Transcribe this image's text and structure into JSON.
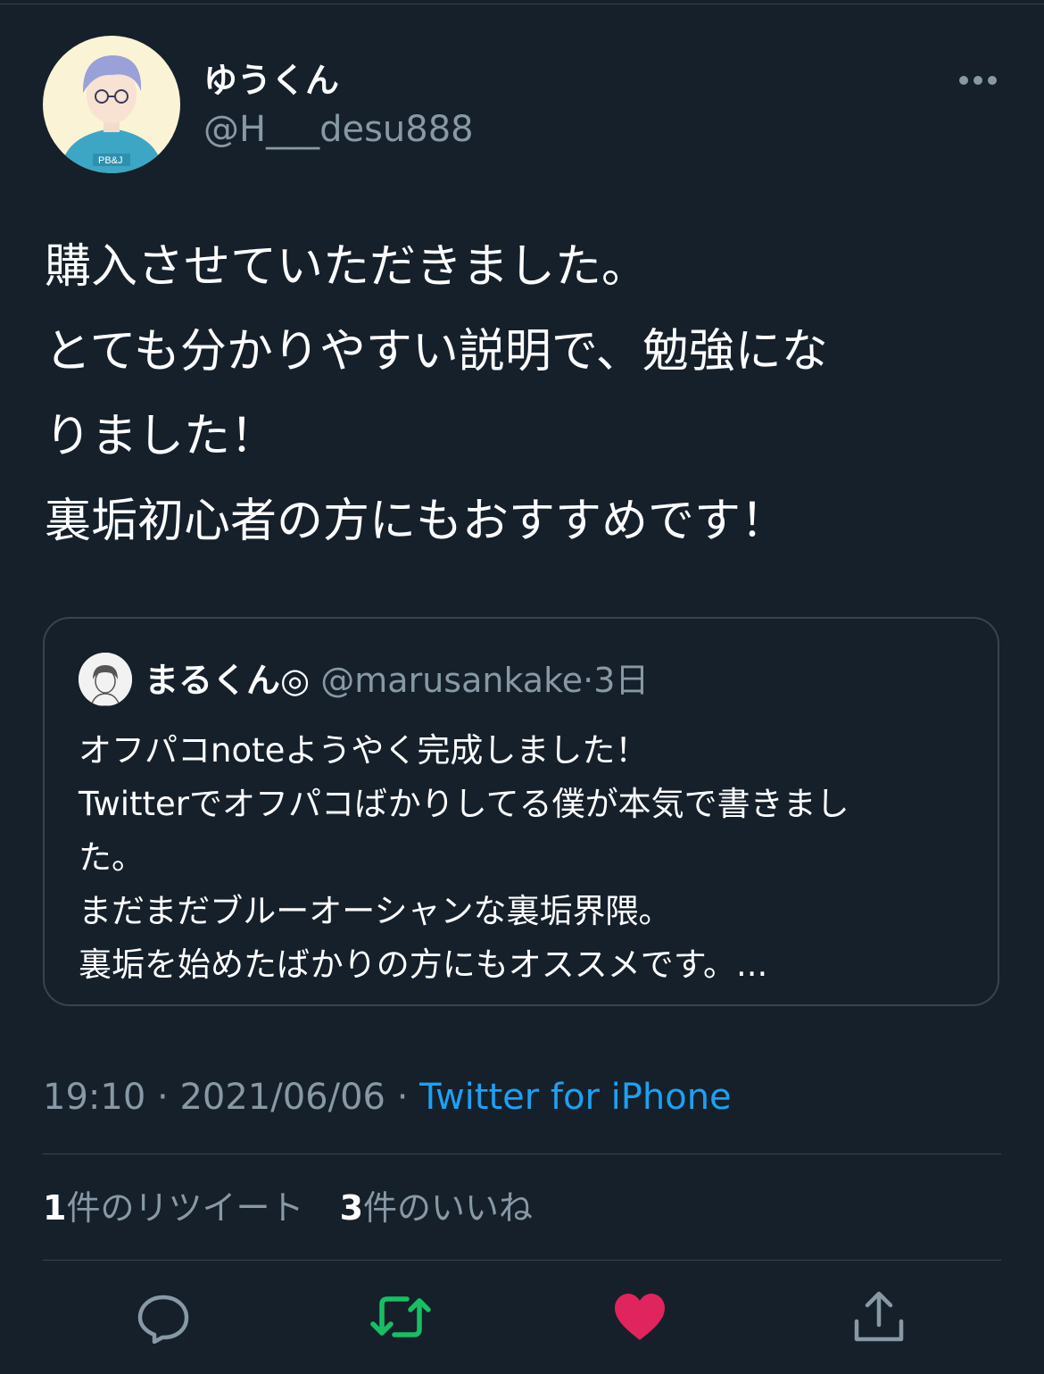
{
  "tweet": {
    "display_name": "ゆうくん",
    "handle": "@H___desu888",
    "lines": [
      "購入させていただきました。",
      "とても分かりやすい説明で、勉強にな",
      "りました！",
      "裏垢初心者の方にもおすすめです！"
    ],
    "time": "19:10",
    "date": "2021/06/06",
    "separator": "·",
    "client": "Twitter for iPhone"
  },
  "quote": {
    "name": "まるくん",
    "badge": "◎",
    "handle": "@marusankake",
    "separator": "·",
    "age": "3日",
    "lines": [
      "オフパコnoteようやく完成しました！",
      "Twitterでオフパコばかりしてる僕が本気で書きまし",
      "た。",
      "まだまだブルーオーシャンな裏垢界隈。",
      "裏垢を始めたばかりの方にもオススメです。..."
    ]
  },
  "stats": {
    "retweet_count": "1",
    "retweet_label": "件のリツイート",
    "like_count": "3",
    "like_label": "件のいいね"
  },
  "actions": {
    "reply_icon": "reply-icon",
    "retweet_icon": "retweet-icon",
    "like_icon": "heart-icon",
    "share_icon": "share-icon"
  },
  "colors": {
    "background": "#15202b",
    "muted_text": "#8899a6",
    "link": "#1da1f2",
    "retweet_active": "#17bf63",
    "like_active": "#e0245e",
    "border": "#38444d"
  }
}
